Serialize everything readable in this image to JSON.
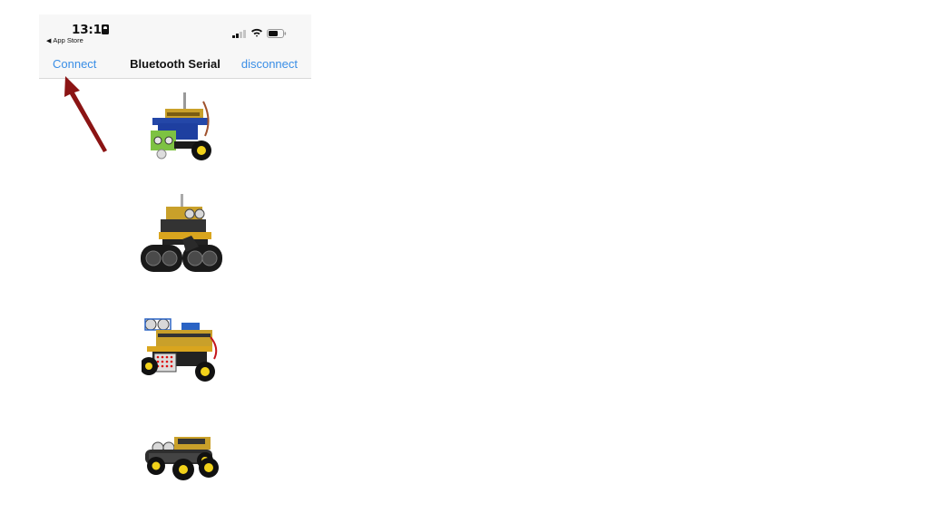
{
  "status_bar": {
    "time": "13:13",
    "back_label": "App Store",
    "back_arrow": "◀",
    "icons": [
      "id-card-icon",
      "cellular-signal-icon",
      "wifi-icon",
      "battery-icon"
    ]
  },
  "nav": {
    "left_button": "Connect",
    "title": "Bluetooth Serial",
    "right_button": "disconnect"
  },
  "robots": [
    {
      "name": "robot-car-image-1",
      "description_icon": "robot-car-icon"
    },
    {
      "name": "tank-robot-image",
      "description_icon": "robot-tank-icon"
    },
    {
      "name": "robot-car-image-3",
      "description_icon": "robot-car-icon"
    },
    {
      "name": "robot-car-4wd-image",
      "description_icon": "robot-car-icon"
    }
  ],
  "annotation": {
    "arrow_color": "#8b1414",
    "points_to": "Connect"
  },
  "colors": {
    "accent": "#3a8ee6",
    "nav_background": "#f7f7f7"
  }
}
